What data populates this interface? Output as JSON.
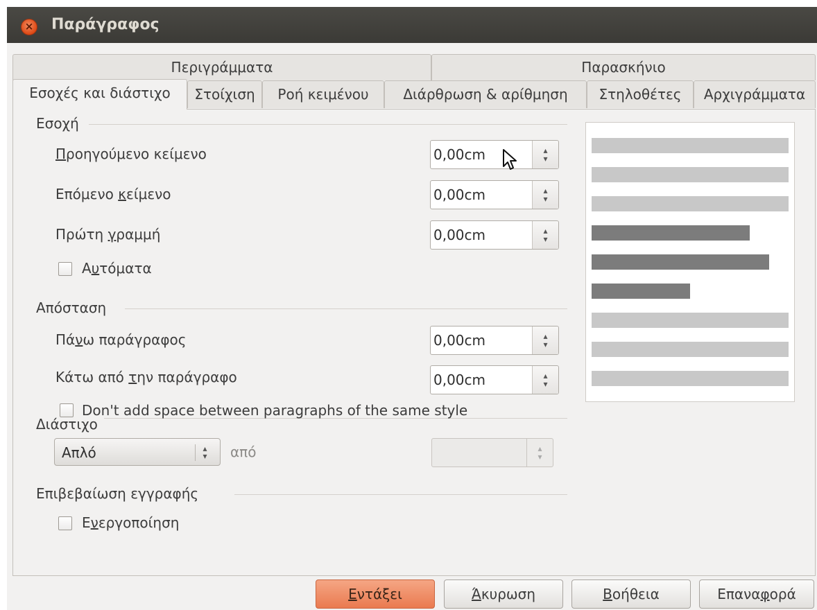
{
  "window": {
    "title": "Παράγραφος",
    "close_glyph": "×"
  },
  "tabs_top": [
    {
      "label": "Περιγράμματα"
    },
    {
      "label": "Παρασκήνιο"
    }
  ],
  "tabs": [
    {
      "label": "Εσοχές και διάστιχο",
      "active": true
    },
    {
      "label": "Στοίχιση"
    },
    {
      "label": "Ροή κειμένου"
    },
    {
      "label": "Διάρθρωση & αρίθμηση"
    },
    {
      "label": "Στηλοθέτες"
    },
    {
      "label": "Αρχιγράμματα"
    }
  ],
  "indent": {
    "heading": "Εσοχή",
    "before_text": {
      "label_first": "Π",
      "label_rest": "ροηγούμενο κείμενο",
      "value": "0,00cm"
    },
    "after_text": {
      "label_first": "Επόμενο ",
      "label_u": "κ",
      "label_rest": "είμενο",
      "value": "0,00cm"
    },
    "first_line": {
      "label_first": "Πρώτη ",
      "label_u": "γ",
      "label_rest": "ραμμή",
      "value": "0,00cm"
    },
    "automatic": {
      "label_first": "Α",
      "label_u": "υ",
      "label_rest": "τόματα",
      "checked": false
    }
  },
  "spacing": {
    "heading": "Απόσταση",
    "above": {
      "label_first": "Πά",
      "label_u": "ν",
      "label_rest": "ω παράγραφος",
      "value": "0,00cm"
    },
    "below": {
      "label_first": "Κάτω από ",
      "label_u": "τ",
      "label_rest": "ην παράγραφο",
      "value": "0,00cm"
    },
    "no_space_same_style": {
      "label": "Don't add space between paragraphs of the same style",
      "checked": false
    }
  },
  "line_spacing": {
    "heading": "Διάστιχο",
    "selected": "Απλό",
    "of_label": "από",
    "value": ""
  },
  "register_true": {
    "heading": "Επιβεβαίωση εγγραφής",
    "activate": {
      "label_first": "Ε",
      "label_u": "ν",
      "label_rest": "εργοποίηση",
      "checked": false
    }
  },
  "buttons": {
    "ok": {
      "u": "Ε",
      "rest": "ντάξει"
    },
    "cancel": {
      "u": "Ά",
      "rest": "κυρωση"
    },
    "help": {
      "u": "Β",
      "rest": "οήθεια"
    },
    "reset": {
      "first": "Επανα",
      "u": "φ",
      "rest": "ορά"
    }
  },
  "colors": {
    "accent": "#ea7a50",
    "titlebar": "#3b3a36",
    "preview_light": "#c8c8c8",
    "preview_dark": "#7c7c7c"
  }
}
